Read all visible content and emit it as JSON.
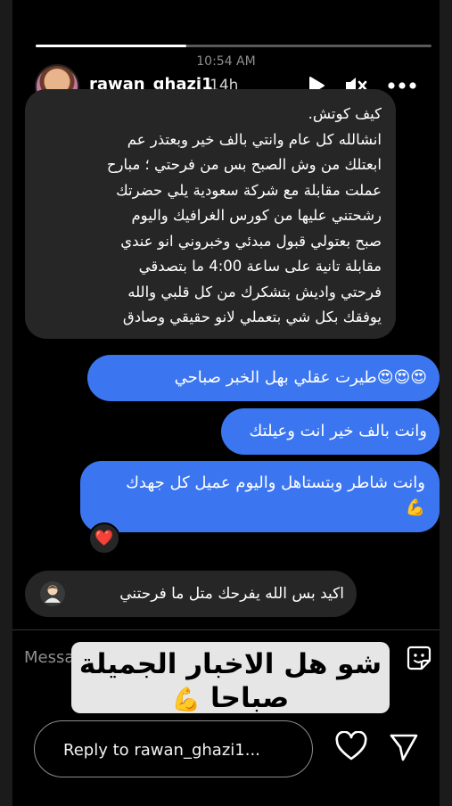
{
  "story": {
    "status_time": "10:54 AM",
    "progress": 0.38,
    "username": "rawan_ghazi1",
    "time_ago": "14h"
  },
  "messages": [
    {
      "id": "m1",
      "side": "incoming",
      "lines": [
        "كيف كوتش.",
        "انشالله كل عام وانتي بالف خير وبعتذر عم",
        "ابعتلك من وش الصبح بس من فرحتي ؛ مبارح",
        "عملت مقابلة مع شركة سعودية يلي حضرتك",
        "رشحتني عليها من كورس الغرافيك واليوم",
        "صبح بعتولي قبول مبدئي وخبروني انو عندي",
        "مقابلة تانية على ساعة 4:00 ما بتصدقي",
        "فرحتي واديش بتشكرك من كل قلبي والله",
        "يوفقك بكل شي بتعملي لانو حقيقي وصادق"
      ]
    },
    {
      "id": "m2",
      "side": "outgoing",
      "text": "😍😍😍طيرت عقلي بهل الخبر صباحي"
    },
    {
      "id": "m3",
      "side": "outgoing",
      "text": "وانت بالف خير انت وعيلتك"
    },
    {
      "id": "m4",
      "side": "outgoing",
      "text": "وانت شاطر وبتستاهل واليوم عميل كل جهدك",
      "reaction": "❤️"
    },
    {
      "id": "m5",
      "side": "incoming",
      "text": "اكيد  بس الله يفرحك متل ما فرحتني"
    }
  ],
  "composer": {
    "placeholder": "Messa"
  },
  "overlay_caption": {
    "line1": "شو هل الاخبار الجميلة",
    "line2": "صباحا"
  },
  "reply": {
    "placeholder": "Reply to rawan_ghazi1..."
  },
  "icons": {
    "play": "play-icon",
    "mute": "mute-icon",
    "more": "more-icon",
    "sticker": "sticker-icon",
    "heart": "heart-icon",
    "send": "send-icon",
    "flexed_biceps": "flexed-biceps-icon",
    "person": "person-icon"
  },
  "colors": {
    "outgoing_bubble": "#3b76f0",
    "incoming_bubble": "#262626",
    "story_bg": "#000000",
    "caption_bg": "#e6e6e6"
  }
}
